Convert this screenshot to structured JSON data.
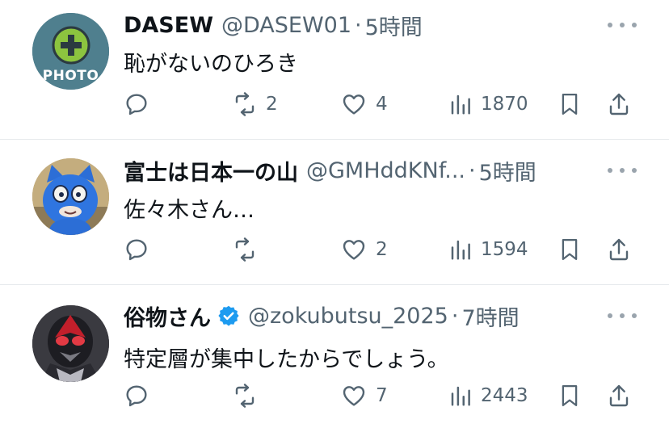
{
  "tweets": [
    {
      "name": "DASEW",
      "handle": "@DASEW01",
      "time": "5時間",
      "text": "恥がないのひろき",
      "avatar_label": "PHOTO",
      "verified": false,
      "retweets": "2",
      "likes": "4",
      "views": "1870"
    },
    {
      "name": "富士は日本一の山",
      "handle": "@GMHddKNf...",
      "time": "5時間",
      "text": "佐々木さん…",
      "verified": false,
      "retweets": "",
      "likes": "2",
      "views": "1594"
    },
    {
      "name": "俗物さん",
      "handle": "@zokubutsu_2025",
      "time": "7時間",
      "text": "特定層が集中したからでしょう。",
      "verified": true,
      "retweets": "",
      "likes": "7",
      "views": "2443"
    }
  ],
  "separator": "·",
  "colors": {
    "text_primary": "#0f1419",
    "text_secondary": "#536471",
    "verified_blue": "#1d9bf0",
    "divider": "#e6e9ec"
  },
  "icons": [
    "reply-icon",
    "retweet-icon",
    "like-icon",
    "views-icon",
    "bookmark-icon",
    "share-icon",
    "more-icon",
    "verified-icon"
  ]
}
